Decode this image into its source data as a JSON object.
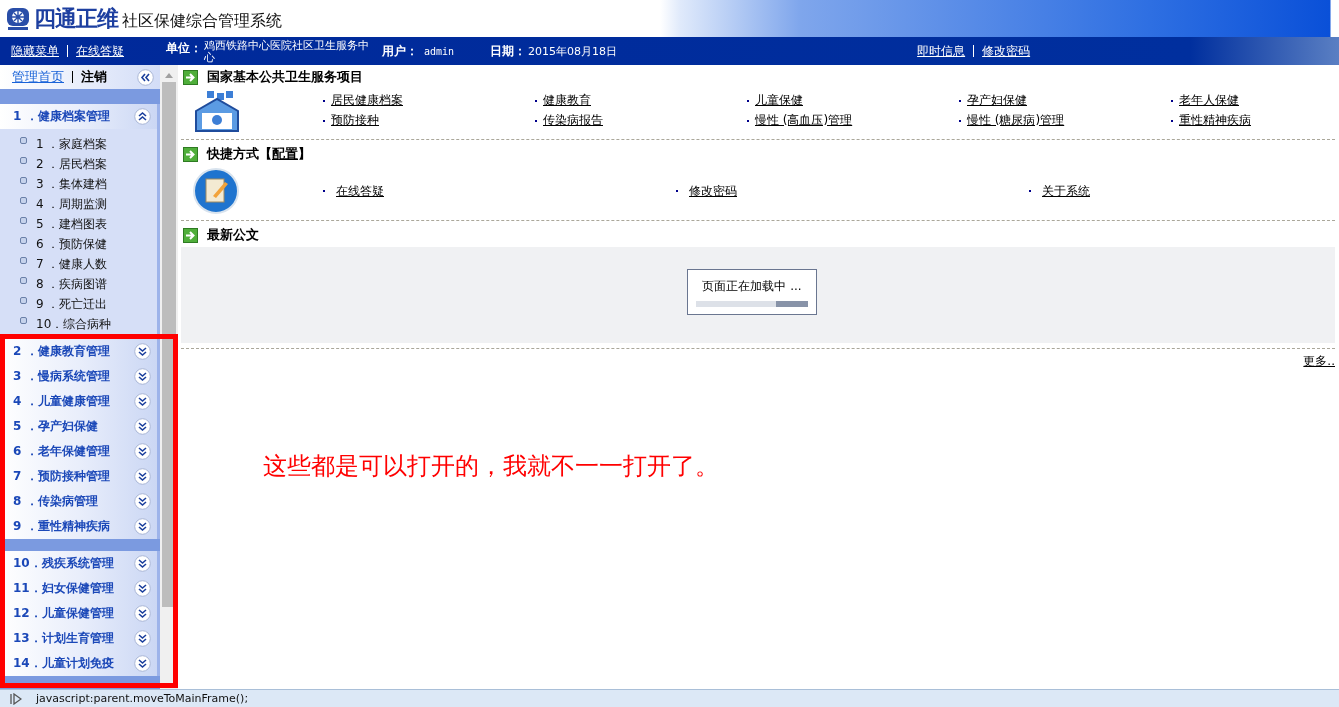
{
  "header": {
    "logo_text": "四通正维",
    "title": "社区保健综合管理系统"
  },
  "nav": {
    "left_links": [
      "隐藏菜单",
      "在线答疑"
    ],
    "unit": {
      "label": "单位：",
      "value": "鸡西铁路中心医院社区卫生服务中心"
    },
    "user": {
      "label": "用户：",
      "value": "admin"
    },
    "date": {
      "label": "日期：",
      "value": "2015年08月18日"
    },
    "right_links": [
      "即时信息",
      "修改密码"
    ]
  },
  "sidebar": {
    "top_links": [
      {
        "label": "管理首页",
        "selected": true
      },
      {
        "label": "注销",
        "selected": false
      }
    ],
    "panels": [
      {
        "groups": [
          {
            "label": "1 ．健康档案管理",
            "expanded": true,
            "children": [
              "1 ．家庭档案",
              "2 ．居民档案",
              "3 ．集体建档",
              "4 ．周期监测",
              "5 ．建档图表",
              "6 ．预防保健",
              "7 ．健康人数",
              "8 ．疾病图谱",
              "9 ．死亡迁出",
              "10．综合病种"
            ]
          }
        ]
      },
      {
        "groups": [
          {
            "label": "2 ．健康教育管理",
            "expanded": false
          },
          {
            "label": "3 ．慢病系统管理",
            "expanded": false
          },
          {
            "label": "4 ．儿童健康管理",
            "expanded": false
          },
          {
            "label": "5 ．孕产妇保健",
            "expanded": false
          },
          {
            "label": "6 ．老年保健管理",
            "expanded": false
          },
          {
            "label": "7 ．预防接种管理",
            "expanded": false
          },
          {
            "label": "8 ．传染病管理",
            "expanded": false
          },
          {
            "label": "9 ．重性精神疾病",
            "expanded": false
          }
        ]
      },
      {
        "groups": [
          {
            "label": "10．残疾系统管理",
            "expanded": false
          },
          {
            "label": "11．妇女保健管理",
            "expanded": false
          },
          {
            "label": "12．儿童保健管理",
            "expanded": false
          },
          {
            "label": "13．计划生育管理",
            "expanded": false
          },
          {
            "label": "14．儿童计划免疫",
            "expanded": false
          }
        ]
      }
    ]
  },
  "services": {
    "title": "国家基本公共卫生服务项目",
    "links": [
      "居民健康档案",
      "健康教育",
      "儿童保健",
      "孕产妇保健",
      "老年人保健",
      "预防接种",
      "传染病报告",
      "慢性 (高血压)管理",
      "慢性 (糖尿病)管理",
      "重性精神疾病"
    ]
  },
  "shortcuts": {
    "title": "快捷方式【",
    "config_link": "配置",
    "title_end": "】",
    "links": [
      "在线答疑",
      "修改密码",
      "关于系统"
    ]
  },
  "documents": {
    "title": "最新公文",
    "loading_text": "页面正在加载中 ...",
    "more_link": "更多.."
  },
  "annotation": {
    "text": "这些都是可以打开的，我就不一一打开了。"
  },
  "status_bar": {
    "text": "javascript:parent.moveToMainFrame();"
  }
}
